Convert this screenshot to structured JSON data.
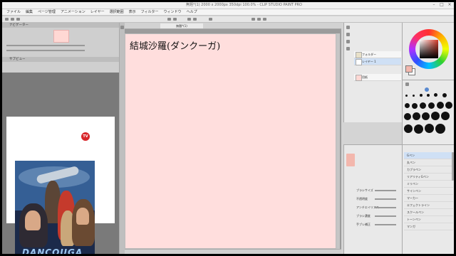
{
  "window": {
    "title": "無題*(1) 2000 x 2000px 350dpi 100.0% - CLIP STUDIO PAINT PRO"
  },
  "menu": {
    "items": [
      "ファイル",
      "編集",
      "ページ管理",
      "アニメーション",
      "レイヤー",
      "選択範囲",
      "表示",
      "フィルター",
      "ウィンドウ",
      "ヘルプ"
    ]
  },
  "navigator": {
    "header": "ナビゲーター"
  },
  "reference": {
    "header": "サブビュー",
    "poster_logo": "DANCOUGA",
    "tv_badge": "TV"
  },
  "canvas": {
    "tab_label": "無題*(1)",
    "text": "結城沙羅(ダンクーガ)",
    "background_color": "#ffdedd"
  },
  "layers": {
    "items": [
      "フォルダー",
      "レイヤー 1",
      "用紙"
    ]
  },
  "tool_property": {
    "rows": [
      "ブラシサイズ",
      "不透明度",
      "アンチエイリアス",
      "ブラシ濃度",
      "手ブレ補正"
    ]
  },
  "subtool": {
    "rows": [
      "Gペン",
      "丸ペン",
      "カブラペン",
      "リアリティGペン",
      "ミリペン",
      "サインペン",
      "マーカー",
      "エフェクトライン",
      "スクールペン",
      "トーンペン",
      "マンガ"
    ]
  },
  "colors": {
    "main": "#f3b7ad",
    "sub": "#ffffff",
    "accent": "#d43a2a"
  }
}
